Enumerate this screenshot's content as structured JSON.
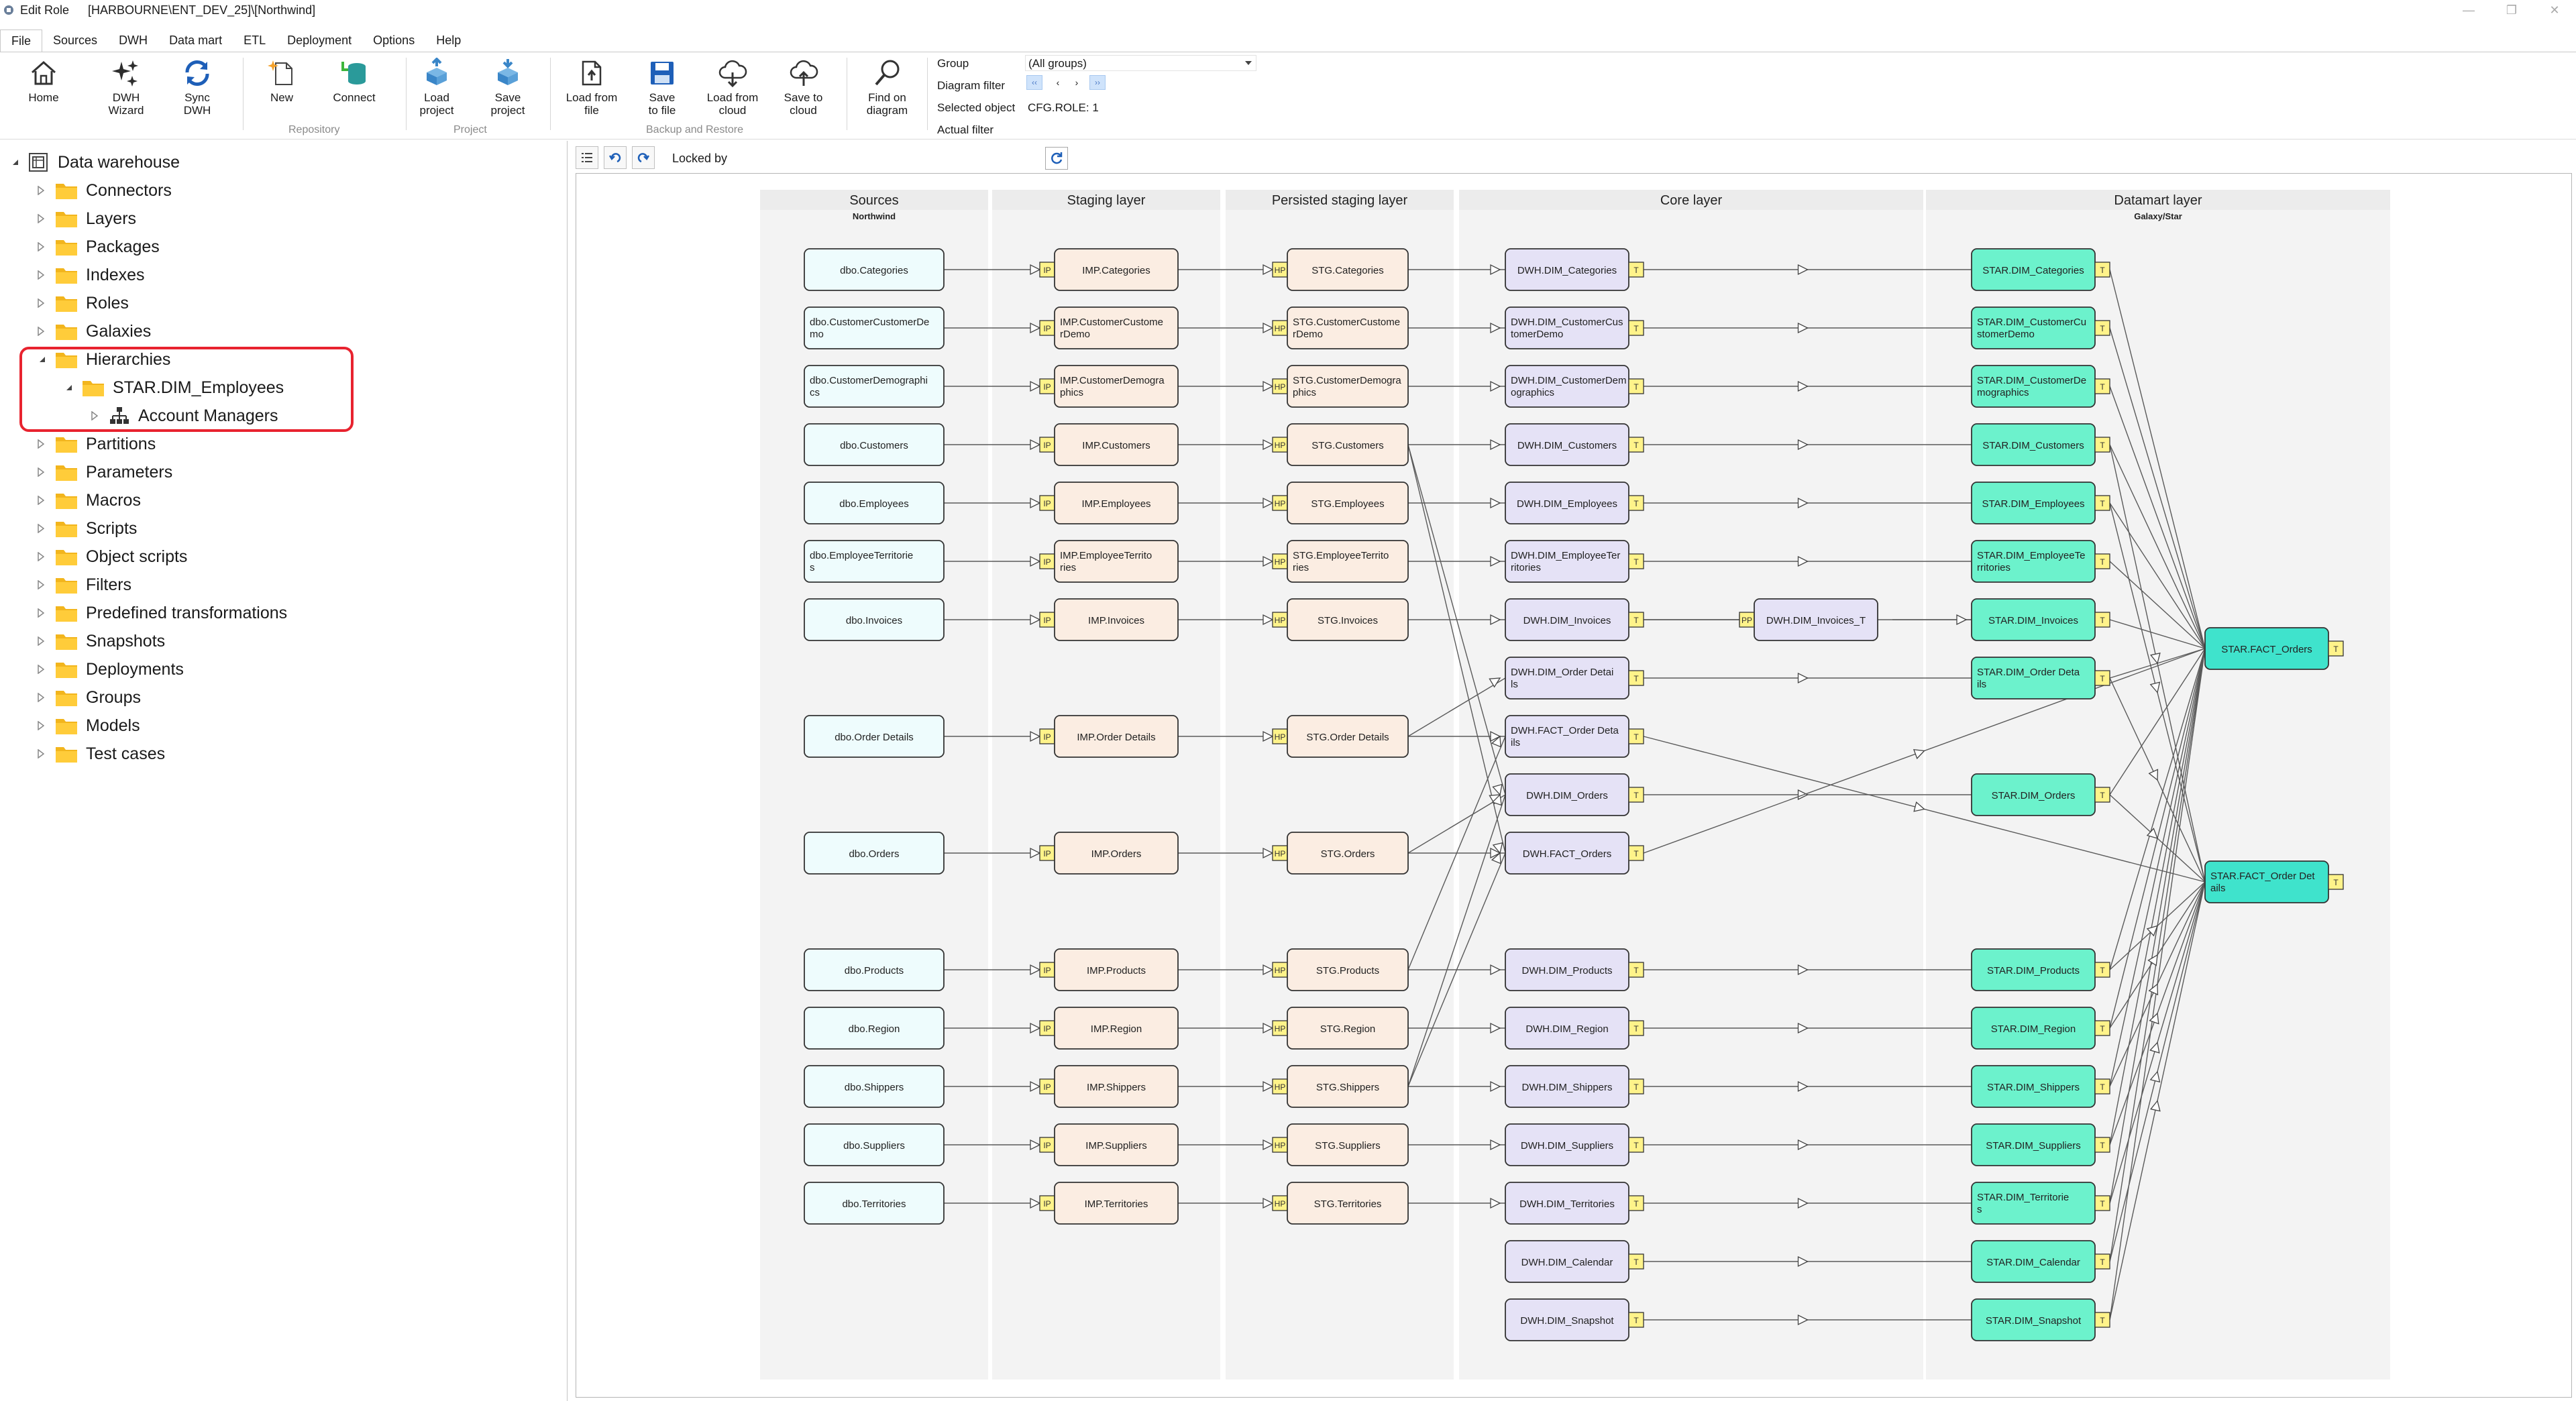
{
  "window": {
    "app": "Edit Role",
    "path": "[HARBOURNE\\ENT_DEV_25]\\[Northwind]"
  },
  "menu": [
    "File",
    "Sources",
    "DWH",
    "Data mart",
    "ETL",
    "Deployment",
    "Options",
    "Help"
  ],
  "ribbon": {
    "buttons": [
      {
        "label": "Home",
        "icon": "home-icon"
      },
      {
        "label": "DWH Wizard",
        "icon": "wizard-icon"
      },
      {
        "label": "Sync DWH",
        "icon": "sync-icon"
      },
      {
        "label": "New",
        "icon": "new-icon"
      },
      {
        "label": "Connect",
        "icon": "connect-icon"
      },
      {
        "label": "Load project",
        "icon": "load-project-icon"
      },
      {
        "label": "Save project",
        "icon": "save-project-icon"
      },
      {
        "label": "Load from file",
        "icon": "load-file-icon"
      },
      {
        "label": "Save to file",
        "icon": "save-file-icon"
      },
      {
        "label": "Load from cloud",
        "icon": "cloud-download-icon"
      },
      {
        "label": "Save to cloud",
        "icon": "cloud-upload-icon"
      },
      {
        "label": "Find on diagram",
        "icon": "magnifier-icon"
      }
    ],
    "groups": [
      "Repository",
      "Project",
      "Backup and Restore"
    ],
    "filters": {
      "group_label": "Group",
      "group_value": "(All groups)",
      "diagram_filter_label": "Diagram filter",
      "selected_object_label": "Selected object",
      "selected_object_value": "CFG.ROLE: 1",
      "actual_filter_label": "Actual filter"
    }
  },
  "tree": {
    "root": "Data warehouse",
    "items": [
      "Connectors",
      "Layers",
      "Packages",
      "Indexes",
      "Roles",
      "Galaxies",
      "Hierarchies",
      "Partitions",
      "Parameters",
      "Macros",
      "Scripts",
      "Object scripts",
      "Filters",
      "Predefined transformations",
      "Snapshots",
      "Deployments",
      "Groups",
      "Models",
      "Test cases"
    ],
    "hierarchy_child": "STAR.DIM_Employees",
    "hierarchy_grandchild": "Account Managers"
  },
  "diagram_toolbar": {
    "locked_by_label": "Locked by"
  },
  "diagram": {
    "columns": [
      {
        "title": "Sources",
        "subtitle": "Northwind"
      },
      {
        "title": "Staging layer",
        "subtitle": ""
      },
      {
        "title": "Persisted staging layer",
        "subtitle": ""
      },
      {
        "title": "Core layer",
        "subtitle": ""
      },
      {
        "title": "Datamart layer",
        "subtitle": "Galaxy/Star"
      }
    ],
    "rows": [
      {
        "src": "dbo.Categories",
        "imp": "IMP.Categories",
        "stg": "STG.Categories",
        "dwh": "DWH.DIM_Categories",
        "star": "STAR.DIM_Categories"
      },
      {
        "src": "dbo.CustomerCustomerDemo",
        "imp": "IMP.CustomerCustomerDemo",
        "stg": "STG.CustomerCustomerDemo",
        "dwh": "DWH.DIM_CustomerCustomerDemo",
        "star": "STAR.DIM_CustomerCustomerDemo"
      },
      {
        "src": "dbo.CustomerDemographics",
        "imp": "IMP.CustomerDemographics",
        "stg": "STG.CustomerDemographics",
        "dwh": "DWH.DIM_CustomerDemographics",
        "star": "STAR.DIM_CustomerDemographics"
      },
      {
        "src": "dbo.Customers",
        "imp": "IMP.Customers",
        "stg": "STG.Customers",
        "dwh": "DWH.DIM_Customers",
        "star": "STAR.DIM_Customers"
      },
      {
        "src": "dbo.Employees",
        "imp": "IMP.Employees",
        "stg": "STG.Employees",
        "dwh": "DWH.DIM_Employees",
        "star": "STAR.DIM_Employees"
      },
      {
        "src": "dbo.EmployeeTerritories",
        "imp": "IMP.EmployeeTerritories",
        "stg": "STG.EmployeeTerritories",
        "dwh": "DWH.DIM_EmployeeTerritories",
        "star": "STAR.DIM_EmployeeTerritories"
      },
      {
        "src": "dbo.Invoices",
        "imp": "IMP.Invoices",
        "stg": "STG.Invoices",
        "dwh": "DWH.DIM_Invoices",
        "star": "STAR.DIM_Invoices"
      },
      {
        "src": null,
        "imp": null,
        "stg": null,
        "dwh": "DWH.DIM_Order Details",
        "star": "STAR.DIM_Order Details"
      },
      {
        "src": "dbo.Order Details",
        "imp": "IMP.Order Details",
        "stg": "STG.Order Details",
        "dwh": "DWH.FACT_Order Details",
        "star": null
      },
      {
        "src": null,
        "imp": null,
        "stg": null,
        "dwh": "DWH.DIM_Orders",
        "star": "STAR.DIM_Orders"
      },
      {
        "src": "dbo.Orders",
        "imp": "IMP.Orders",
        "stg": "STG.Orders",
        "dwh": "DWH.FACT_Orders",
        "star": null
      },
      {
        "src": null,
        "imp": null,
        "stg": null,
        "dwh": null,
        "star": null
      },
      {
        "src": "dbo.Products",
        "imp": "IMP.Products",
        "stg": "STG.Products",
        "dwh": "DWH.DIM_Products",
        "star": "STAR.DIM_Products"
      },
      {
        "src": "dbo.Region",
        "imp": "IMP.Region",
        "stg": "STG.Region",
        "dwh": "DWH.DIM_Region",
        "star": "STAR.DIM_Region"
      },
      {
        "src": "dbo.Shippers",
        "imp": "IMP.Shippers",
        "stg": "STG.Shippers",
        "dwh": "DWH.DIM_Shippers",
        "star": "STAR.DIM_Shippers"
      },
      {
        "src": "dbo.Suppliers",
        "imp": "IMP.Suppliers",
        "stg": "STG.Suppliers",
        "dwh": "DWH.DIM_Suppliers",
        "star": "STAR.DIM_Suppliers"
      },
      {
        "src": "dbo.Territories",
        "imp": "IMP.Territories",
        "stg": "STG.Territories",
        "dwh": "DWH.DIM_Territories",
        "star": "STAR.DIM_Territories"
      },
      {
        "src": null,
        "imp": null,
        "stg": null,
        "dwh": "DWH.DIM_Calendar",
        "star": "STAR.DIM_Calendar"
      },
      {
        "src": null,
        "imp": null,
        "stg": null,
        "dwh": "DWH.DIM_Snapshot",
        "star": "STAR.DIM_Snapshot"
      }
    ],
    "extra_node": "DWH.DIM_Invoices_T",
    "facts": [
      "STAR.FACT_Orders",
      "STAR.FACT_Order Details"
    ],
    "badges": {
      "imp": "IP",
      "stg": "HP",
      "pre": "PP",
      "trans": "T"
    },
    "colors": {
      "src": "#eefcfd",
      "imp": "#fbede2",
      "stg": "#fbede2",
      "dwh": "#e5e2f6",
      "star": "#6cf2cc",
      "fact": "#3fe3cc",
      "badge": "#fff38a"
    }
  }
}
